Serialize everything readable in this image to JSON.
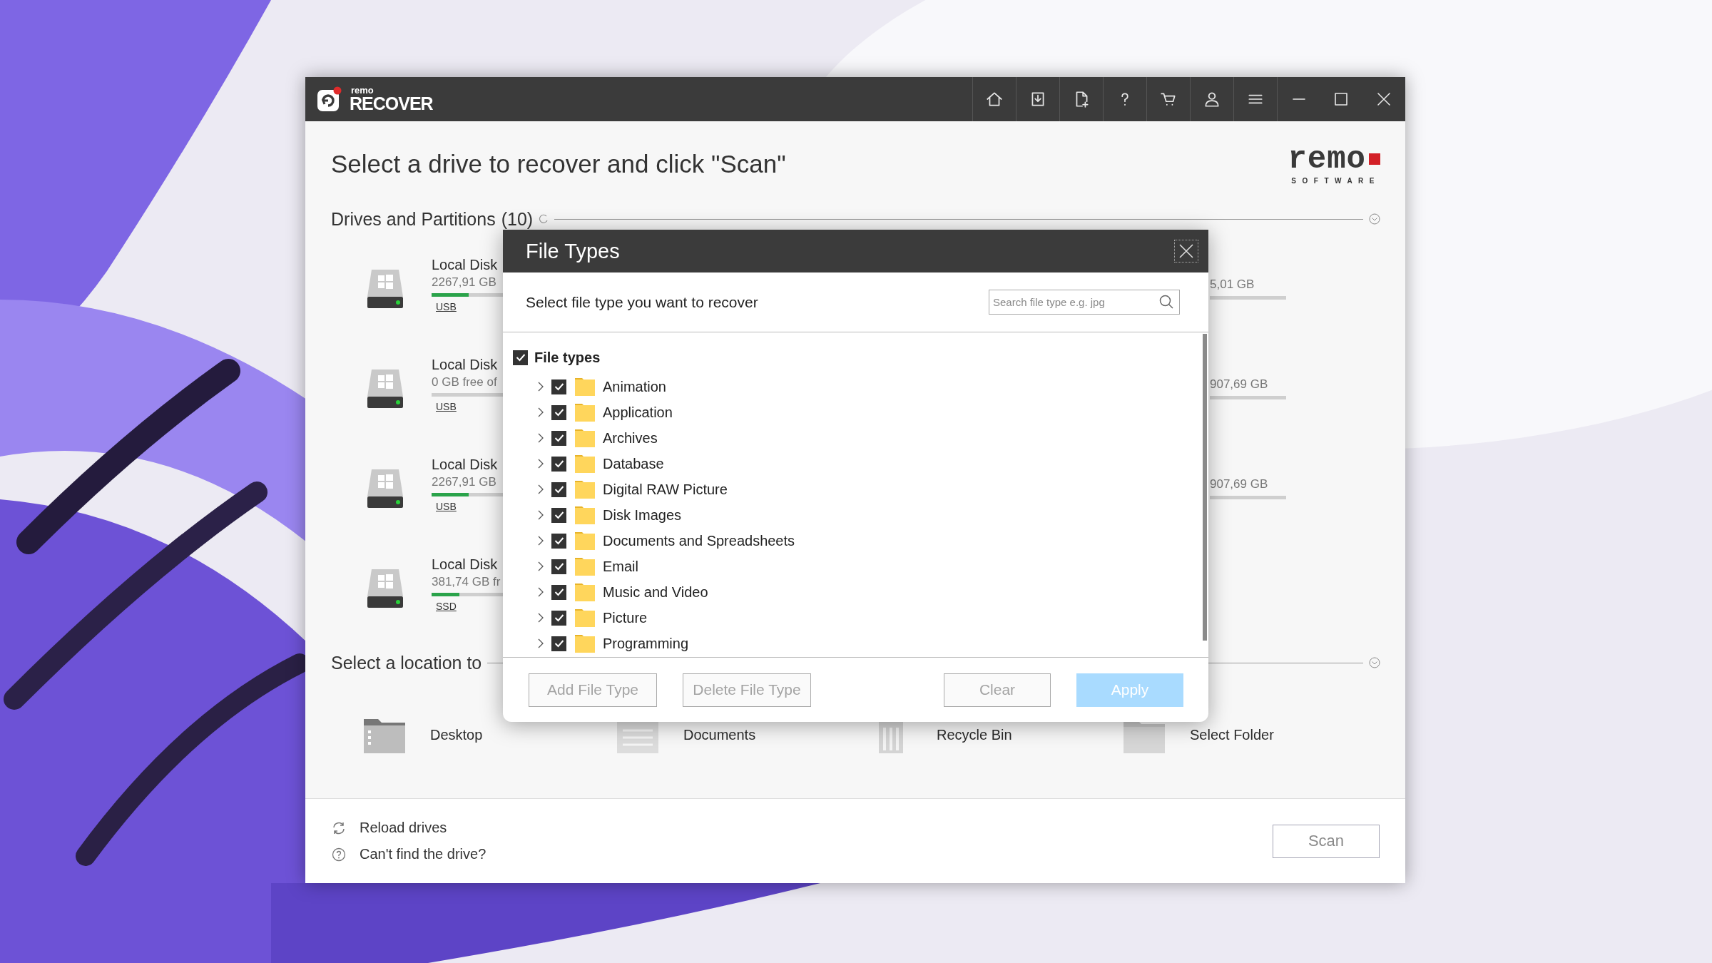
{
  "app": {
    "logo_top": "remo",
    "logo_name": "RECOVER"
  },
  "heading": "Select a drive to recover and click \"Scan\"",
  "brand": {
    "name": "remo",
    "tagline": "SOFTWARE"
  },
  "drives_section": {
    "title": "Drives and Partitions",
    "count": "(10)"
  },
  "drives": [
    {
      "name": "Local Disk",
      "info": "2267,91 GB",
      "level": 0.2,
      "bus": "USB"
    },
    {
      "name": "Local Disk",
      "info": "0 GB free of",
      "level": 0,
      "bus": "USB"
    },
    {
      "name": "Local Disk",
      "info": "2267,91 GB",
      "level": 0.2,
      "bus": "USB"
    },
    {
      "name": "Local Disk",
      "info": "381,74 GB fr",
      "level": 0.15,
      "bus": "SSD"
    }
  ],
  "drives_column_3": [
    {
      "info": "5,01 GB"
    },
    {
      "info": "907,69 GB"
    },
    {
      "info": "907,69 GB"
    }
  ],
  "locations_section": {
    "title": "Select a location to"
  },
  "locations": [
    {
      "kind": "desktop",
      "label": "Desktop"
    },
    {
      "kind": "documents",
      "label": "Documents"
    },
    {
      "kind": "recycle",
      "label": "Recycle Bin"
    },
    {
      "kind": "folder",
      "label": "Select Folder"
    }
  ],
  "footer": {
    "links": [
      {
        "kind": "reload",
        "label": "Reload drives"
      },
      {
        "kind": "help",
        "label": "Can't find the drive?"
      }
    ],
    "scan": {
      "label": "Scan",
      "disabled": true
    }
  },
  "dialog": {
    "title": "File Types",
    "prompt": "Select file type you want to recover",
    "search": {
      "placeholder": "Search file type e.g. jpg"
    },
    "tree": {
      "label": "File types",
      "checked": true,
      "children": [
        {
          "label": "Animation",
          "checked": true,
          "expanded": false
        },
        {
          "label": "Application",
          "checked": true,
          "expanded": false
        },
        {
          "label": "Archives",
          "checked": true,
          "expanded": false
        },
        {
          "label": "Database",
          "checked": true,
          "expanded": false
        },
        {
          "label": "Digital RAW Picture",
          "checked": true,
          "expanded": false
        },
        {
          "label": "Disk Images",
          "checked": true,
          "expanded": false
        },
        {
          "label": "Documents and Spreadsheets",
          "checked": true,
          "expanded": false
        },
        {
          "label": "Email",
          "checked": true,
          "expanded": false
        },
        {
          "label": "Music and Video",
          "checked": true,
          "expanded": false
        },
        {
          "label": "Picture",
          "checked": true,
          "expanded": false
        },
        {
          "label": "Programming",
          "checked": true,
          "expanded": false
        }
      ]
    },
    "buttons": [
      {
        "kind": "secondary",
        "label": "Add File Type",
        "disabled": true
      },
      {
        "kind": "secondary",
        "label": "Delete File Type",
        "disabled": true
      },
      {
        "kind": "secondary",
        "label": "Clear",
        "disabled": true
      },
      {
        "kind": "primary",
        "label": "Apply",
        "disabled": true
      }
    ]
  }
}
